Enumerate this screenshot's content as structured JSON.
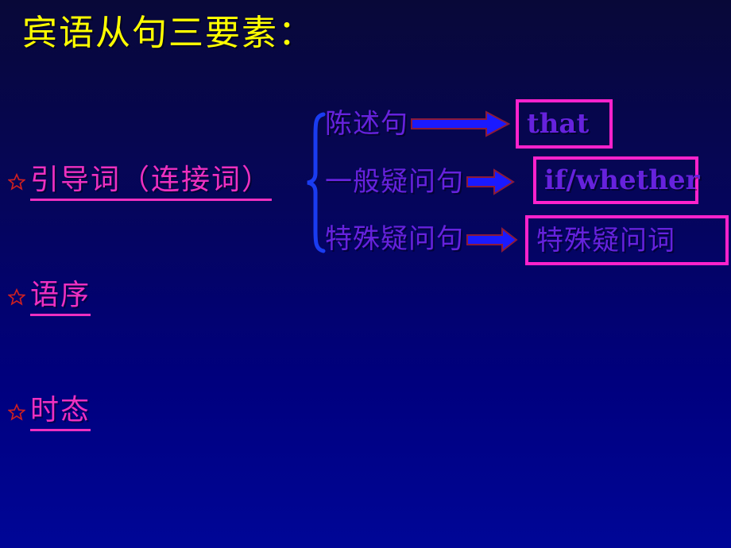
{
  "slide": {
    "title": "宾语从句三要素：",
    "background_top_color": "#080838",
    "background_bottom_color": "#000697",
    "title_color": "#ffff00"
  },
  "bullets": [
    {
      "icon": "star-bullet",
      "label": "引导词（连接词）",
      "color": "#ee30c0"
    },
    {
      "icon": "star-bullet",
      "label": "语序",
      "color": "#ee30c0"
    },
    {
      "icon": "star-bullet",
      "label": "时态",
      "color": "#ee30c0"
    }
  ],
  "diagram": {
    "brace_color": "#1a3cf0",
    "arrow_fill": "#1a1aff",
    "arrow_outline": "#8b1a3a",
    "box_border_color": "#ff22cc",
    "label_color": "#6622dd",
    "rows": [
      {
        "sentence_type": "陈述句",
        "arrow": "right-arrow-long",
        "result": "that",
        "result_script": "latin"
      },
      {
        "sentence_type": "一般疑问句",
        "arrow": "right-arrow-short",
        "result": "if/whether",
        "result_script": "latin"
      },
      {
        "sentence_type": "特殊疑问句",
        "arrow": "right-arrow-mid",
        "result": "特殊疑问词",
        "result_script": "cjk"
      }
    ]
  }
}
